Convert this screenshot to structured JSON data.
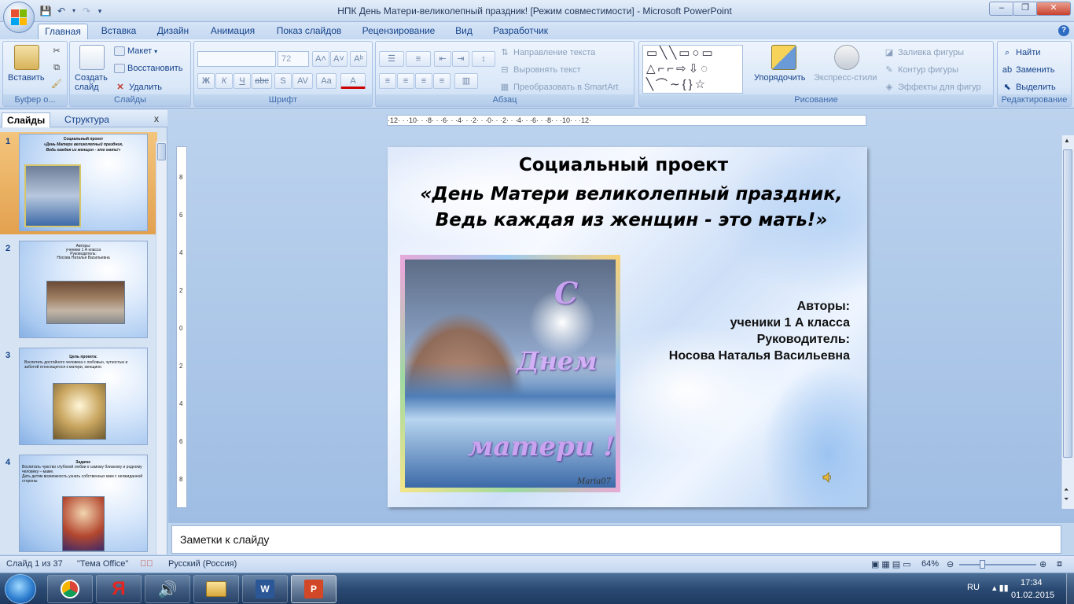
{
  "window": {
    "title": "НПК  День Матери-великолепный праздник! [Режим совместимости] - Microsoft PowerPoint",
    "minimize": "‒",
    "restore": "❐",
    "close": "✕"
  },
  "tabs": [
    "Главная",
    "Вставка",
    "Дизайн",
    "Анимация",
    "Показ слайдов",
    "Рецензирование",
    "Вид",
    "Разработчик"
  ],
  "ribbon": {
    "clipboard": {
      "label": "Буфер о...",
      "paste": "Вставить"
    },
    "slides": {
      "label": "Слайды",
      "new_slide": "Создать слайд",
      "layout": "Макет",
      "reset": "Восстановить",
      "delete": "Удалить"
    },
    "font": {
      "label": "Шрифт",
      "font_name": "",
      "font_size": "72",
      "bold": "Ж",
      "italic": "К",
      "underline": "Ч",
      "strike": "abc",
      "spacing": "AV",
      "case": "Aa",
      "color": "A"
    },
    "paragraph": {
      "label": "Абзац",
      "text_direction": "Направление текста",
      "align_text": "Выровнять текст",
      "smartart": "Преобразовать в SmartArt"
    },
    "drawing": {
      "label": "Рисование",
      "arrange": "Упорядочить",
      "quick_styles": "Экспресс-стили",
      "fill": "Заливка фигуры",
      "outline": "Контур фигуры",
      "effects": "Эффекты для фигур"
    },
    "editing": {
      "label": "Редактирование",
      "find": "Найти",
      "replace": "Заменить",
      "select": "Выделить"
    }
  },
  "left_pane": {
    "tabs": [
      "Слайды",
      "Структура"
    ],
    "close": "x",
    "slides": [
      {
        "num": "1",
        "lines": [
          "Социальный проект",
          "«День Матери великолепный праздник,",
          "Ведь каждая из женщин - это мать!»"
        ]
      },
      {
        "num": "2",
        "lines": [
          "Авторы:",
          "ученики 1 А класса",
          "Руководитель:",
          "Носова Наталья Васильевна"
        ]
      },
      {
        "num": "3",
        "lines": [
          "Цель проекта:",
          "Воспитать достойного человека с любовью, чуткостью и заботой относящегося к матери, женщине."
        ]
      },
      {
        "num": "4",
        "lines": [
          "Задачи:",
          "Воспитать чувство глубокой любви к самому близкому и родному человеку – маме.",
          "Дать детям возможность узнать собственных мам с неожиданной стороны"
        ]
      }
    ]
  },
  "slide": {
    "title": "Социальный проект",
    "subtitle_1": "«День Матери великолепный праздник,",
    "subtitle_2": "Ведь каждая из женщин - это мать!»",
    "authors": [
      "Авторы:",
      "ученики   1 А класса",
      "Руководитель:",
      "Носова Наталья  Васильевна"
    ],
    "photo_text": {
      "s": "С",
      "dnem": "Днем",
      "materi": "матери !",
      "sign": "Maria07"
    }
  },
  "rulers": {
    "h": "·12· · ·10· · ·8· · ·6· · ·4· · ·2· · ·0· · ·2· · ·4· · ·6· · ·8· · ·10· · ·12·",
    "v": [
      "8",
      "6",
      "4",
      "2",
      "0",
      "2",
      "4",
      "6",
      "8"
    ]
  },
  "notes": {
    "placeholder": "Заметки к слайду"
  },
  "status": {
    "slide": "Слайд 1 из 37",
    "theme": "\"Тема Office\"",
    "language": "Русский (Россия)",
    "zoom": "64%"
  },
  "taskbar": {
    "lang": "RU",
    "time": "17:34",
    "date": "01.02.2015"
  },
  "colors": {
    "accent": "#15428b",
    "ribbon_bg": "#d8e6f8",
    "selected_thumb": "#e9a857"
  }
}
